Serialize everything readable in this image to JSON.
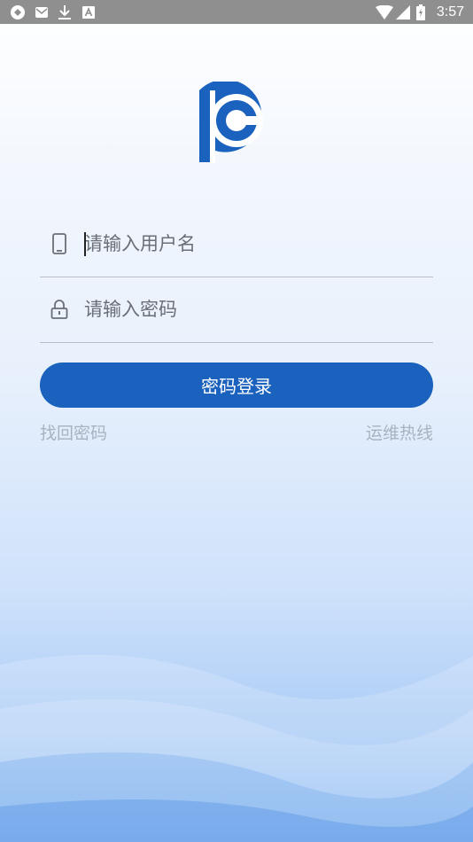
{
  "status_bar": {
    "time": "3:57",
    "icons": [
      "vpn-icon",
      "message-icon",
      "download-icon",
      "text-icon",
      "wifi-icon",
      "signal-icon",
      "battery-icon"
    ]
  },
  "logo": {
    "icon": "pc-logo",
    "color": "#1a62bd"
  },
  "login": {
    "username_placeholder": "请输入用户名",
    "username_value": "",
    "password_placeholder": "请输入密码",
    "password_value": "",
    "login_button": "密码登录",
    "forgot_password": "找回密码",
    "hotline": "运维热线"
  },
  "colors": {
    "accent": "#1a62bd",
    "link": "#a8b2c0",
    "status_bar": "#8f8f8f"
  }
}
